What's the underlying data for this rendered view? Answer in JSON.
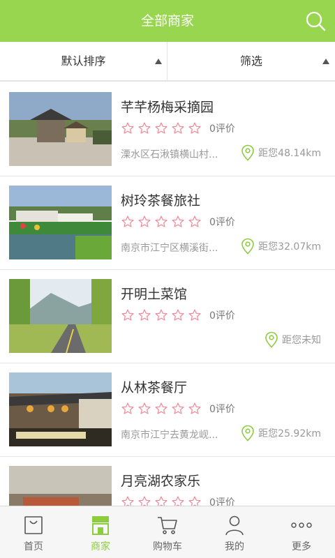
{
  "header": {
    "title": "全部商家",
    "search_icon": "search-icon"
  },
  "filters": [
    {
      "label": "默认排序",
      "icon": "triangle-up-icon"
    },
    {
      "label": "筛选",
      "icon": "triangle-up-icon"
    }
  ],
  "colors": {
    "brand_green": "#99d64f",
    "star_pink": "#f08c9a",
    "pin_green": "#8ccc3d"
  },
  "merchants": [
    {
      "name": "芊芊杨梅采摘园",
      "rating": 0,
      "reviews": "0评价",
      "address": "溧水区石湫镇横山村...",
      "distance": "距您48.14km"
    },
    {
      "name": "树玲茶餐旅社",
      "rating": 0,
      "reviews": "0评价",
      "address": "南京市江宁区横溪街...",
      "distance": "距您32.07km"
    },
    {
      "name": "开明土菜馆",
      "rating": 0,
      "reviews": "0评价",
      "address": "",
      "distance": "距您未知"
    },
    {
      "name": "从林茶餐厅",
      "rating": 0,
      "reviews": "0评价",
      "address": "南京市江宁去黄龙岘...",
      "distance": "距您25.92km"
    },
    {
      "name": "月亮湖农家乐",
      "rating": 0,
      "reviews": "0评价",
      "address": "",
      "distance": ""
    }
  ],
  "tabs": [
    {
      "label": "首页",
      "icon": "shopping-bag-icon",
      "active": false
    },
    {
      "label": "商家",
      "icon": "storefront-icon",
      "active": true
    },
    {
      "label": "购物车",
      "icon": "cart-icon",
      "active": false
    },
    {
      "label": "我的",
      "icon": "person-icon",
      "active": false
    },
    {
      "label": "更多",
      "icon": "more-dots-icon",
      "active": false
    }
  ]
}
